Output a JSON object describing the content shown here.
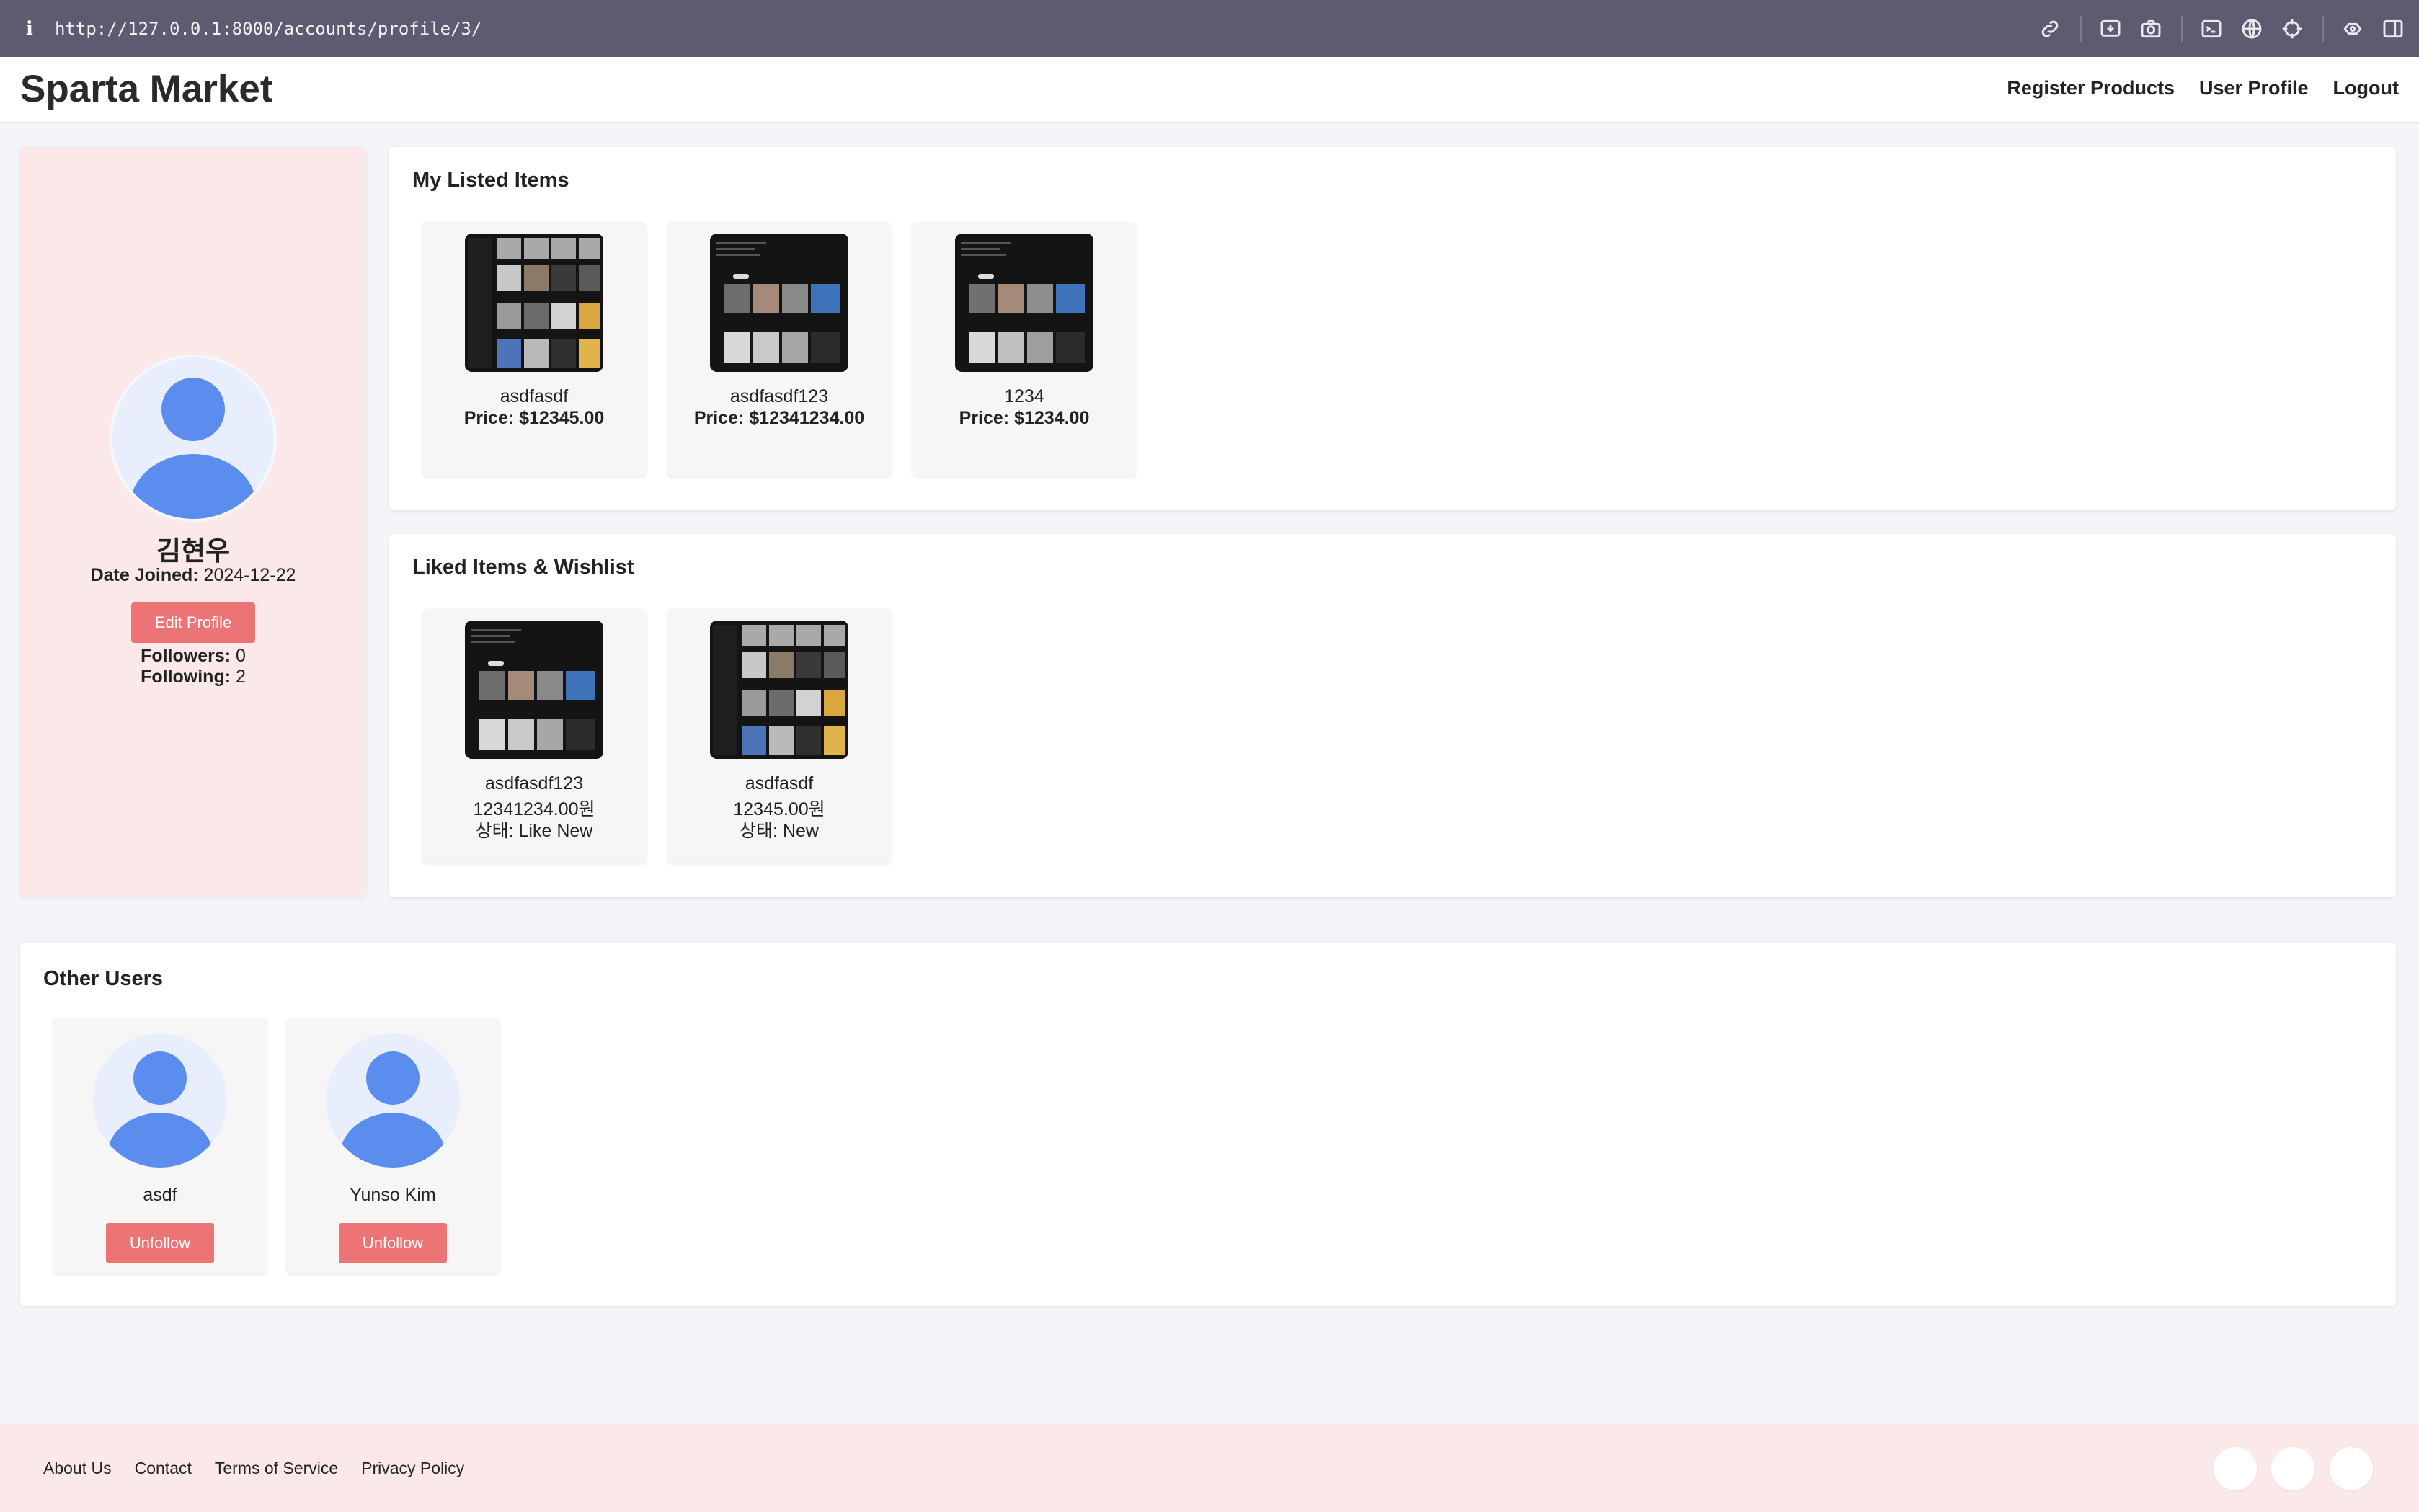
{
  "browser": {
    "info_icon": "info-icon",
    "url": "http://127.0.0.1:8000/accounts/profile/3/",
    "toolbar_icons": [
      "link-icon",
      "download-screen-icon",
      "camera-icon",
      "terminal-icon",
      "globe-icon",
      "crosshair-icon",
      "extensions-icon",
      "sidebar-icon"
    ]
  },
  "header": {
    "brand": "Sparta Market",
    "nav": {
      "register": "Register Products",
      "profile": "User Profile",
      "logout": "Logout"
    }
  },
  "profile": {
    "name": "김현우",
    "date_joined_label": "Date Joined:",
    "date_joined": "2024-12-22",
    "edit_button": "Edit Profile",
    "followers_label": "Followers:",
    "followers": "0",
    "following_label": "Following:",
    "following": "2"
  },
  "listed": {
    "title": "My Listed Items",
    "items": [
      {
        "name": "asdfasdf",
        "price": "Price: $12345.00"
      },
      {
        "name": "asdfasdf123",
        "price": "Price: $12341234.00"
      },
      {
        "name": "1234",
        "price": "Price: $1234.00"
      }
    ]
  },
  "liked": {
    "title": "Liked Items & Wishlist",
    "items": [
      {
        "name": "asdfasdf123",
        "price": "12341234.00원",
        "status": "상태: Like New"
      },
      {
        "name": "asdfasdf",
        "price": "12345.00원",
        "status": "상태: New"
      }
    ]
  },
  "others": {
    "title": "Other Users",
    "users": [
      {
        "name": "asdf",
        "button": "Unfollow"
      },
      {
        "name": "Yunso Kim",
        "button": "Unfollow"
      }
    ]
  },
  "footer": {
    "links": [
      "About Us",
      "Contact",
      "Terms of Service",
      "Privacy Policy"
    ],
    "social_icons": [
      "social-icon-1",
      "social-icon-2",
      "social-icon-3"
    ]
  },
  "colors": {
    "accent": "#ec7474",
    "sidebar_bg": "#fbe9e9",
    "avatar_blue": "#5b8def",
    "browser_bar": "#5d5b6f"
  }
}
